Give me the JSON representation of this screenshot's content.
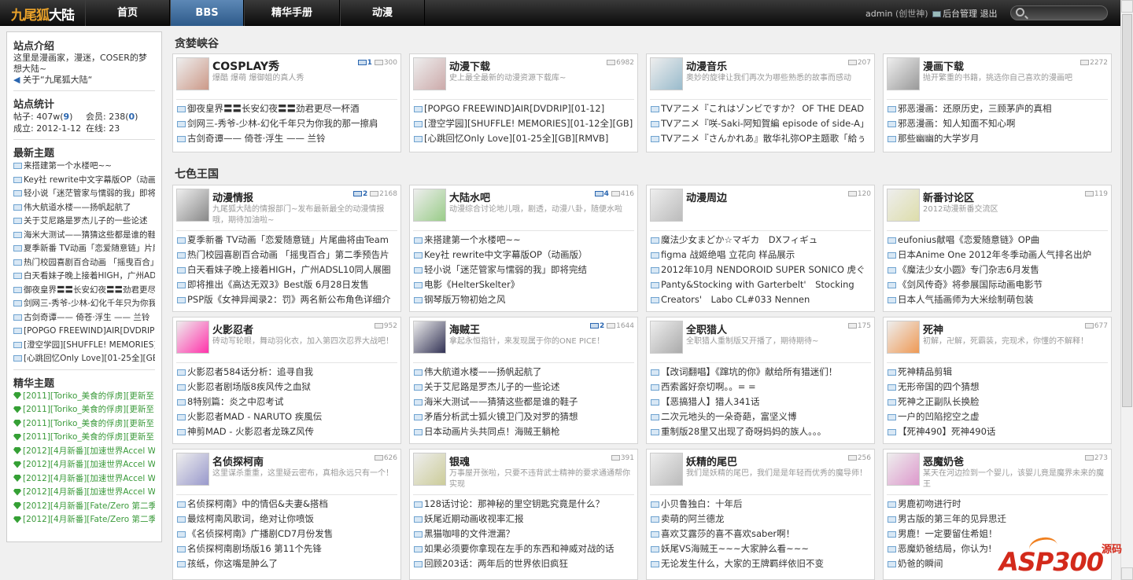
{
  "header": {
    "logo_a": "九尾狐",
    "logo_b": "大陆",
    "nav": [
      "首页",
      "BBS",
      "精华手册",
      "动漫"
    ],
    "user": "admin",
    "role": "(创世神)",
    "admin": "后台管理",
    "logout": "退出"
  },
  "sidebar": {
    "intro_title": "站点介绍",
    "intro_text": "这里是漫画家，漫迷，COSER的梦想大陆~",
    "intro_link": "关于“九尾狐大陆“",
    "stats_title": "站点统计",
    "stats": {
      "posts_label": "帖子: 407w(",
      "posts_new": "9",
      "posts_end": ")",
      "members_label": "会员: 238(",
      "members_new": "0",
      "members_end": ")",
      "founded": "成立: 2012-1-12",
      "online": "在线: 23"
    },
    "latest_title": "最新主题",
    "latest": [
      "来搭建第一个水楼吧~~",
      "Key社 rewrite中文字幕版OP（动画版）",
      "轻小说「迷茫管家与懦弱的我」即将完结",
      "伟大航道水楼——扬帆起航了",
      "关于艾尼路是罗杰儿子的一些论述",
      "海米大测试——猜猜这些都是谁的鞋子",
      "夏季新番 TV动画「恋爱随意链」片尾曲",
      "热门校园喜剧百合动画 「摇曳百合」第二季",
      "白天看妹子晚上接着HIGH，广州ADSL",
      "御夜皇界〓〓长安幻夜〓〓劲君更尽一杯",
      "剑网三-秀爷-少林-幻化千年只为你我的",
      "古剑奇谭—— 倚苍·浮生 —— 兰铃",
      "[POPGO FREEWIND]AIR[DVDRIP][01-12]",
      "[澄空学园][SHUFFLE! MEMORIES][01-12全]",
      "[心跳回忆Only Love][01-25全][GB][RMVB]"
    ],
    "elite_title": "精华主题",
    "elite": [
      "[2011][Toriko_美食的俘虏][更新至",
      "[2011][Toriko_美食的俘虏][更新至",
      "[2011][Toriko_美食的俘虏][更新至",
      "[2011][Toriko_美食的俘虏][更新至",
      "[2012][4月新番][加速世界Accel W",
      "[2012][4月新番][加速世界Accel W",
      "[2012][4月新番][加速世界Accel W",
      "[2012][4月新番][加速世界Accel W",
      "[2012][4月新番][Fate/Zero 第二季",
      "[2012][4月新番][Fate/Zero 第二季"
    ]
  },
  "sections": [
    {
      "title": "贪婪峡谷",
      "boards": [
        {
          "name": "COSPLAY秀",
          "desc": "爆酷 爆萌 爆御姐的真人秀",
          "new": "1",
          "count": "300",
          "topics": [
            "御夜皇界〓〓长安幻夜〓〓劲君更尽一杯酒",
            "剑网三-秀爷-少林-幻化千年只为你我的那一擦肩",
            "古剑奇谭—— 倚苍·浮生 —— 兰铃"
          ]
        },
        {
          "name": "动漫下载",
          "desc": "史上最全最新的动漫资源下载库~",
          "new": "",
          "count": "6982",
          "topics": [
            "[POPGO FREEWIND]AIR[DVDRIP][01-12]",
            "[澄空学园][SHUFFLE! MEMORIES][01-12全][GB]",
            "[心跳回忆Only Love][01-25全][GB][RMVB]"
          ]
        },
        {
          "name": "动漫音乐",
          "desc": "奥妙的旋律让我们再次为哪些熟悉的故事而感动",
          "new": "",
          "count": "207",
          "topics": [
            "TVアニメ『これはゾンビですか？ OF THE DEAD",
            "TVアニメ『咲-Saki-阿知賀編 episode of side-A」",
            "TVアニメ『さんかれあ』散华礼弥OP主题歌「給ぅ"
          ]
        },
        {
          "name": "漫画下载",
          "desc": "抛开繁重的书籍，挑选你自己喜欢的漫画吧",
          "new": "",
          "count": "2272",
          "topics": [
            "邪恶漫画：还原历史，三顾茅庐的真相",
            "邪恶漫画：知人知面不知心啊",
            "那些幽幽的大学岁月"
          ]
        }
      ]
    },
    {
      "title": "七色王国",
      "boards": [
        {
          "name": "动漫情报",
          "desc": "九尾狐大陆的情报部门~发布最新最全的动漫情报哦，期待加油啦~",
          "new": "2",
          "count": "2168",
          "topics": [
            "夏季新番 TV动画「恋爱随意链」片尾曲将由Team",
            "热门校园喜剧百合动画 「摇曳百合」第二季预告片",
            "白天看妹子晚上接着HIGH，广州ADSL10同人展圈",
            "即将推出《高达无双3》Best版 6月28日发售",
            "PSP版《女神异闻录2：罚》两名新公布角色详细介"
          ]
        },
        {
          "name": "大陆水吧",
          "desc": "动漫综合讨论地儿哦，剧透，动漫八卦，随便水啦",
          "new": "4",
          "count": "416",
          "topics": [
            "来搭建第一个水楼吧~~",
            "Key社 rewrite中文字幕版OP（动画版）",
            "轻小说「迷茫管家与懦弱的我」即将完结",
            "电影《HelterSkelter》",
            "钢琴版万物初始之风"
          ]
        },
        {
          "name": "动漫周边",
          "desc": "",
          "new": "",
          "count": "120",
          "topics": [
            "魔法少女まどか☆マギカ　DXフィギュ",
            "figma 战姬绝唱 立花向 样品展示",
            "2012年10月 NENDOROID SUPER SONICO 虎ぐ",
            "Panty&Stocking with Garterbelt'　Stocking",
            "Creators'　Labo CL#033 Nennen"
          ]
        },
        {
          "name": "新番讨论区",
          "desc": "2012动漫新番交流区",
          "new": "",
          "count": "119",
          "topics": [
            "eufonius献唱《恋爱随意链》OP曲",
            "日本Anime One 2012年冬季动画人气排名出炉",
            "《魔法少女小圆》专门杂志6月发售",
            "《剑风传奇》将参展国际动画电影节",
            "日本人气插画师为大米绘制萌包装"
          ]
        },
        {
          "name": "火影忍者",
          "desc": "砖动写轮眼，舞动羽化衣，加入第四次忍界大战吧！",
          "new": "",
          "count": "952",
          "topics": [
            "火影忍者584话分析：追寻自我",
            "火影忍者剧场版8疾风传之血狱",
            "8特别篇：炎之中忍考试",
            "火影忍者MAD - NARUTO 疾風伝",
            "神剪MAD - 火影忍者龙珠Z风传"
          ]
        },
        {
          "name": "海贼王",
          "desc": "拿起永恒指针，来发现属于你的ONE PICE！",
          "new": "2",
          "count": "1644",
          "topics": [
            "伟大航道水楼——扬帆起航了",
            "关于艾尼路是罗杰儿子的一些论述",
            "海米大测试——猜猜这些都是谁的鞋子",
            "矛盾分析武士狐火镜卫门及对罗的猜想",
            "日本动画片头共同点！海贼王躺枪"
          ]
        },
        {
          "name": "全职猎人",
          "desc": "全职猎人重制版又开播了，期待期待~",
          "new": "",
          "count": "175",
          "topics": [
            "【改词翻唱】《蹿坑的你》献给所有猎迷们！",
            "西索酱好奈切啊。。= =",
            "【恶搞猎人】猎人341话",
            "二次元地头的一朵奇葩，富坚义博",
            "重制版28里又出现了奇呀妈妈的族人。。。"
          ]
        },
        {
          "name": "死神",
          "desc": "初解，卍解，死霸装，完现术，你懂的不解释！",
          "new": "",
          "count": "677",
          "topics": [
            "死神精品剪辑",
            "无形帝国的四个猜想",
            "死神之正副队长换脸",
            "一户的凹陷挖空之虚",
            "【死神490】死神490话"
          ]
        },
        {
          "name": "名侦探柯南",
          "desc": "这里谋杀重重，这里疑云密布，真相永远只有一个！",
          "new": "",
          "count": "626",
          "topics": [
            "名侦探柯南》中的情侣&夫妻&搭档",
            "最炫柯南风歌词，绝对让你喷饭",
            "《名侦探柯南》广播剧CD7月份发售",
            "名侦探柯南剧场版16 第11个先锋",
            "孩纸，你这嘴是肿么了"
          ]
        },
        {
          "name": "银魂",
          "desc": "万事屋开张啦，只要不违背武士精神的要求通通帮你实现",
          "new": "",
          "count": "391",
          "topics": [
            "128话讨论：那神秘的里空钥匙究竟是什么？",
            "妖尾近期动画收视率汇报",
            "黑猫咖啡的文件泄漏？",
            "如果必须要你拿现在左手的东西和神威对战的话",
            "回顾203话：两年后的世界依旧疯狂"
          ]
        },
        {
          "name": "妖精的尾巴",
          "desc": "我们是妖精的尾巴，我们是是年轻而优秀的魔导师！",
          "new": "",
          "count": "256",
          "topics": [
            "小贝鲁独白：十年后",
            "卖萌的阿兰德龙",
            "喜欢艾露莎的喜不喜欢saber啊！",
            "妖尾VS海贼王~~~大家肿么看~~~",
            "无论发生什么，大家的王牌羁绊依旧不变"
          ]
        },
        {
          "name": "恶魔奶爸",
          "desc": "某天在河边捡到一个婴儿，该婴儿竟是魔界未来的魔王",
          "new": "",
          "count": "273",
          "topics": [
            "男鹿初吻进行时",
            "男古版的第三年的见异思迁",
            "男鹿！一定要留住希姐！",
            "恶魔奶爸结局，你认为!",
            "奶爸的瞬间"
          ]
        }
      ]
    }
  ],
  "watermark": {
    "text": "ASP300",
    "cn": "源码"
  }
}
